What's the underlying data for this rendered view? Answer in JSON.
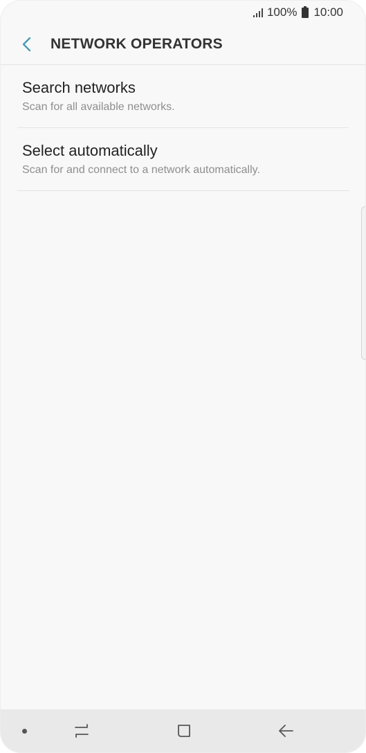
{
  "status_bar": {
    "battery_percent": "100%",
    "time": "10:00",
    "icons": [
      "signal-icon",
      "battery-icon"
    ]
  },
  "header": {
    "back_icon": "chevron-left-icon",
    "title": "NETWORK OPERATORS"
  },
  "list": {
    "items": [
      {
        "title": "Search networks",
        "subtitle": "Scan for all available networks."
      },
      {
        "title": "Select automatically",
        "subtitle": "Scan for and connect to a network automatically."
      }
    ]
  },
  "nav_bar": {
    "icons": [
      "nav-dot-icon",
      "recent-apps-icon",
      "home-icon",
      "back-arrow-icon"
    ]
  },
  "colors": {
    "accent": "#4a9bb3",
    "background": "#f8f8f8",
    "nav_background": "#e9e9e9",
    "text_primary": "#222222",
    "text_secondary": "#8e8e8e"
  }
}
